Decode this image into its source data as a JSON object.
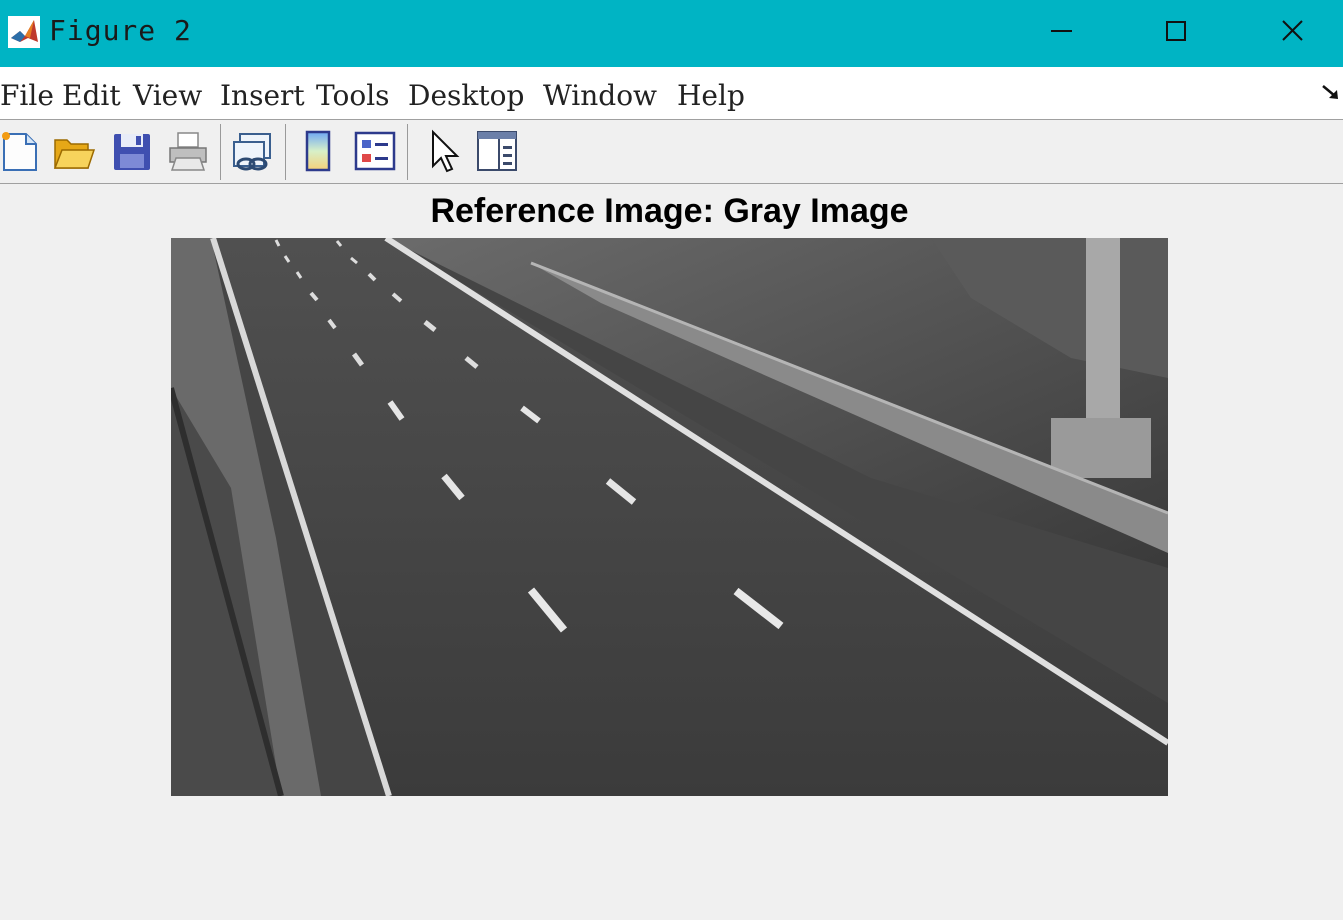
{
  "window": {
    "title": "Figure 2",
    "icon": "matlab-icon",
    "titlebar_color": "#00b4c4",
    "controls": [
      "minimize-icon",
      "maximize-icon",
      "close-icon"
    ]
  },
  "menubar": {
    "items": [
      {
        "label": "File"
      },
      {
        "label": "Edit"
      },
      {
        "label": "View"
      },
      {
        "label": "Insert"
      },
      {
        "label": "Tools"
      },
      {
        "label": "Desktop"
      },
      {
        "label": "Window"
      },
      {
        "label": "Help"
      }
    ],
    "overflow_icon": "arrow-down-right-icon"
  },
  "toolbar": {
    "tools": [
      "new-figure-icon",
      "open-file-icon",
      "save-icon",
      "print-icon",
      "link-plot-icon",
      "insert-colorbar-icon",
      "insert-legend-icon",
      "edit-plot-icon",
      "property-inspector-icon"
    ]
  },
  "figure": {
    "title": "Reference Image: Gray Image",
    "image_description_icon": "grayscale-highway-image"
  }
}
